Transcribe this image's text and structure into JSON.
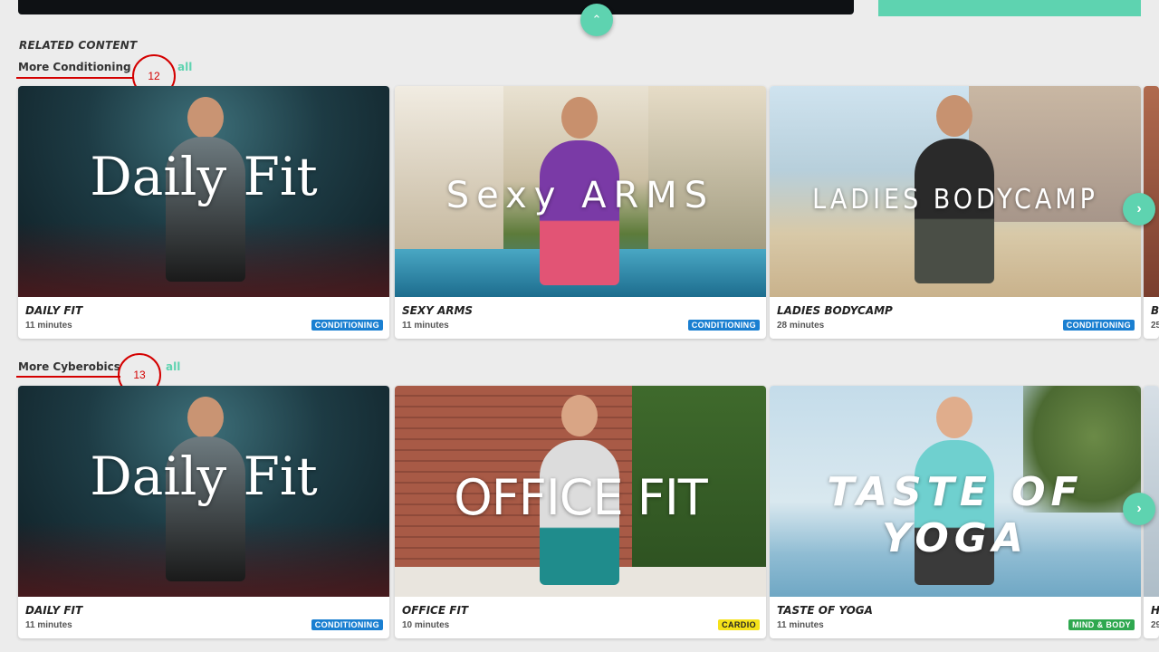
{
  "section_heading": "RELATED CONTENT",
  "colors": {
    "accent": "#5ed3b0",
    "conditioning": "#1a7fd1",
    "cardio": "#f5e11a",
    "mind_body": "#2fa84f",
    "annotation": "#d40000"
  },
  "icons": {
    "collapse": "chevron-up-icon",
    "next": "chevron-right-icon"
  },
  "rows": [
    {
      "title": "More Conditioning",
      "see_all": "all",
      "marker": "12",
      "cards": [
        {
          "title": "DAILY FIT",
          "duration": "11 minutes",
          "badge": "CONDITIONING",
          "logo": "Daily Fit"
        },
        {
          "title": "SEXY ARMS",
          "duration": "11 minutes",
          "badge": "CONDITIONING",
          "logo": "Sexy ARMS"
        },
        {
          "title": "LADIES BODYCAMP",
          "duration": "28 minutes",
          "badge": "CONDITIONING",
          "logo": "LADIES BODYCAMP"
        },
        {
          "title": "B",
          "duration": "25"
        }
      ]
    },
    {
      "title": "More Cyberobics",
      "see_all": "all",
      "marker": "13",
      "cards": [
        {
          "title": "DAILY FIT",
          "duration": "11 minutes",
          "badge": "CONDITIONING",
          "logo": "Daily Fit"
        },
        {
          "title": "OFFICE FIT",
          "duration": "10 minutes",
          "badge": "CARDIO",
          "logo": "OFFICE FIT"
        },
        {
          "title": "TASTE OF YOGA",
          "duration": "11 minutes",
          "badge": "MIND & BODY",
          "logo": "TASTE OF YOGA"
        },
        {
          "title": "H",
          "duration": "29"
        }
      ]
    }
  ],
  "collapse_glyph": "⌃",
  "next_glyph": "›"
}
